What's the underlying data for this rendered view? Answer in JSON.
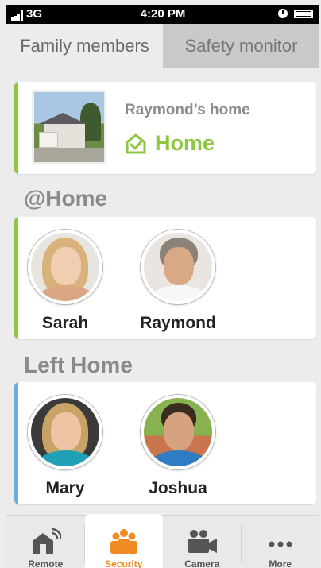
{
  "status_bar": {
    "carrier": "3G",
    "time": "4:20 PM"
  },
  "tabs": [
    {
      "label": "Family members",
      "active": true
    },
    {
      "label": "Safety monitor",
      "active": false
    }
  ],
  "home_card": {
    "owner": "Raymond’s home",
    "status": "Home",
    "accent_color": "#8dc63f"
  },
  "sections": {
    "at_home": {
      "title": "@Home",
      "accent_color": "#8dc63f",
      "people": [
        {
          "name": "Sarah"
        },
        {
          "name": "Raymond"
        }
      ]
    },
    "left_home": {
      "title": "Left Home",
      "accent_color": "#6aaee0",
      "people": [
        {
          "name": "Mary"
        },
        {
          "name": "Joshua"
        }
      ]
    }
  },
  "bottom_nav": {
    "items": [
      {
        "label": "Remote",
        "icon": "house-wifi-icon",
        "active": false
      },
      {
        "label": "Security",
        "icon": "family-group-icon",
        "active": true
      },
      {
        "label": "Camera",
        "icon": "camera-icon",
        "active": false
      },
      {
        "label": "More",
        "icon": "more-dots-icon",
        "active": false
      }
    ],
    "active_color": "#f08a23"
  }
}
